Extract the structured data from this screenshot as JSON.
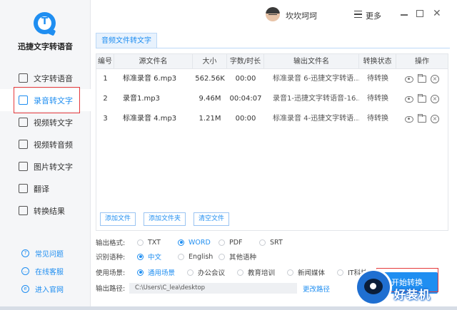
{
  "app": {
    "name": "迅捷文字转语音"
  },
  "sidebar": {
    "items": [
      {
        "label": "文字转语音",
        "icon": "text-to-speech-icon",
        "active": false
      },
      {
        "label": "录音转文字",
        "icon": "recording-to-text-icon",
        "active": true
      },
      {
        "label": "视频转文字",
        "icon": "video-to-text-icon",
        "active": false
      },
      {
        "label": "视频转音频",
        "icon": "video-to-audio-icon",
        "active": false
      },
      {
        "label": "图片转文字",
        "icon": "image-to-text-icon",
        "active": false
      },
      {
        "label": "翻译",
        "icon": "translate-icon",
        "active": false
      },
      {
        "label": "转换结果",
        "icon": "results-icon",
        "active": false
      }
    ],
    "links": [
      {
        "label": "常见问题",
        "icon": "question-icon"
      },
      {
        "label": "在线客服",
        "icon": "chat-icon"
      },
      {
        "label": "进入官网",
        "icon": "globe-icon"
      }
    ]
  },
  "titlebar": {
    "username": "坎坎坷坷",
    "more_label": "更多"
  },
  "main": {
    "tab_label": "音频文件转文字",
    "table": {
      "headers": [
        "编号",
        "源文件名",
        "大小",
        "字数/时长",
        "输出文件名",
        "转换状态",
        "操作"
      ],
      "rows": [
        {
          "no": "1",
          "source": "标准录音 6.mp3",
          "size": "562.56K",
          "duration": "00:00",
          "output": "标准录音 6-迅捷文字转语...",
          "status": "待转换"
        },
        {
          "no": "2",
          "source": "录音1.mp3",
          "size": "9.46M",
          "duration": "00:04:07",
          "output": "录音1-迅捷文字转语音-16...",
          "status": "待转换"
        },
        {
          "no": "3",
          "source": "标准录音 4.mp3",
          "size": "1.21M",
          "duration": "00:00",
          "output": "标准录音 4-迅捷文字转语...",
          "status": "待转换"
        }
      ]
    },
    "buttons": {
      "add_file": "添加文件",
      "add_folder": "添加文件夹",
      "clear_files": "清空文件"
    },
    "output_format": {
      "label": "输出格式:",
      "options": [
        "TXT",
        "WORD",
        "PDF",
        "SRT"
      ],
      "selected": "WORD"
    },
    "language": {
      "label": "识别语种:",
      "options": [
        "中文",
        "English",
        "其他语种"
      ],
      "selected": "中文"
    },
    "scene": {
      "label": "使用场景:",
      "options": [
        "通用场景",
        "办公会议",
        "教育培训",
        "新闻媒体",
        "IT科技"
      ],
      "selected": "通用场景"
    },
    "output_path": {
      "label": "输出路径:",
      "value": "C:\\Users\\C_lea\\desktop",
      "change_label": "更改路径"
    },
    "start_button": "开始转换"
  },
  "watermark": {
    "text": "好装机"
  },
  "colors": {
    "accent": "#1f8ef1",
    "highlight": "#e5393b"
  }
}
